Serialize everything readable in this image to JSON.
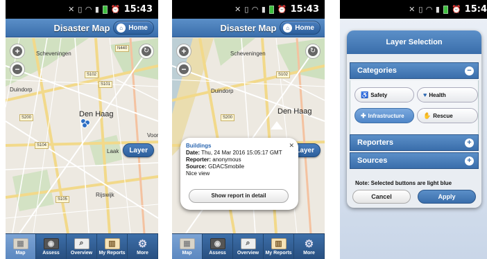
{
  "status": {
    "time": "15:43",
    "time_clipped": "15:4"
  },
  "header": {
    "title": "Disaster Map",
    "home_label": "Home"
  },
  "map": {
    "places": {
      "scheveningen": "Scheveningen",
      "duindorp": "Duindorp",
      "den_haag": "Den Haag",
      "laak": "Laak",
      "rijswijk": "Rijswijk",
      "voor": "Voor"
    },
    "roads": [
      "N440",
      "S102",
      "S200",
      "S104",
      "S105",
      "S101"
    ],
    "layer_label": "Layer"
  },
  "popup": {
    "title": "Buildings",
    "date_label": "Date:",
    "date_value": "Thu, 24 Mar 2016 15:05:17 GMT",
    "reporter_label": "Reporter:",
    "reporter_value": "anonymous",
    "source_label": "Source:",
    "source_value": "GDACSmobile",
    "comment": "Nice view",
    "detail_button": "Show report in detail"
  },
  "tabs": [
    {
      "label": "Map",
      "icon": "map-icon"
    },
    {
      "label": "Assess",
      "icon": "camera-icon"
    },
    {
      "label": "Overview",
      "icon": "magnifier-icon"
    },
    {
      "label": "My Reports",
      "icon": "reports-icon"
    },
    {
      "label": "More",
      "icon": "gear-icon"
    }
  ],
  "layer_selection": {
    "title": "Layer Selection",
    "categories_label": "Categories",
    "categories": [
      {
        "label": "Safety",
        "selected": false
      },
      {
        "label": "Health",
        "selected": false
      },
      {
        "label": "Infrastructure",
        "selected": true
      },
      {
        "label": "Rescue",
        "selected": false
      }
    ],
    "reporters_label": "Reporters",
    "sources_label": "Sources",
    "note": "Note: Selected buttons are light blue",
    "cancel": "Cancel",
    "apply": "Apply"
  },
  "colors": {
    "accent": "#3a6eab",
    "selected": "#4f86c8"
  }
}
